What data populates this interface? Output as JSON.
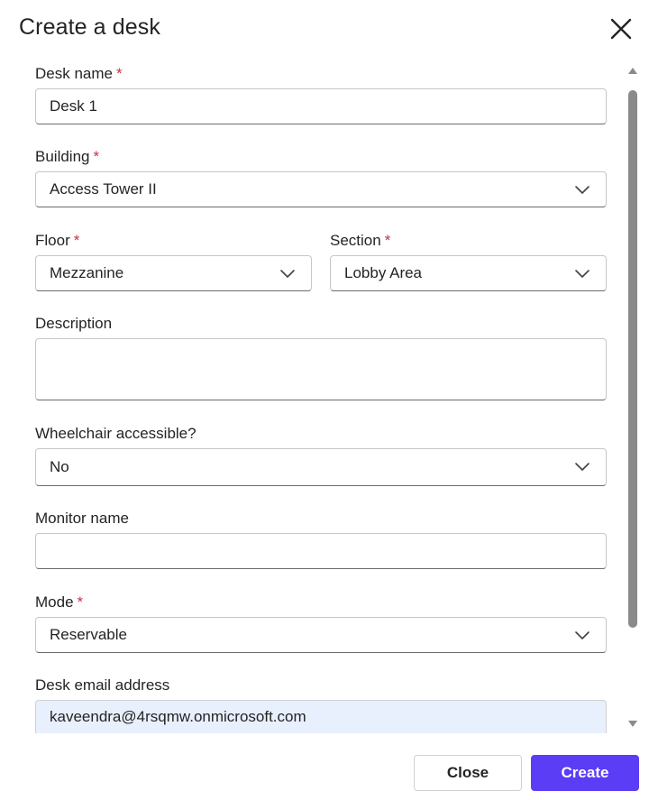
{
  "dialog": {
    "title": "Create a desk",
    "close_icon": "close-icon"
  },
  "form": {
    "desk_name": {
      "label": "Desk name",
      "required": "*",
      "value": "Desk 1"
    },
    "building": {
      "label": "Building",
      "required": "*",
      "value": "Access Tower II"
    },
    "floor": {
      "label": "Floor",
      "required": "*",
      "value": "Mezzanine"
    },
    "section": {
      "label": "Section",
      "required": "*",
      "value": "Lobby Area"
    },
    "description": {
      "label": "Description",
      "value": ""
    },
    "wheelchair": {
      "label": "Wheelchair accessible?",
      "value": "No"
    },
    "monitor_name": {
      "label": "Monitor name",
      "value": ""
    },
    "mode": {
      "label": "Mode",
      "required": "*",
      "value": "Reservable"
    },
    "desk_email": {
      "label": "Desk email address",
      "value": "kaveendra@4rsqmw.onmicrosoft.com"
    }
  },
  "footer": {
    "close_label": "Close",
    "create_label": "Create"
  },
  "colors": {
    "primary": "#5b3df5",
    "required": "#c4314b",
    "autofill_bg": "#e8f0fe"
  }
}
